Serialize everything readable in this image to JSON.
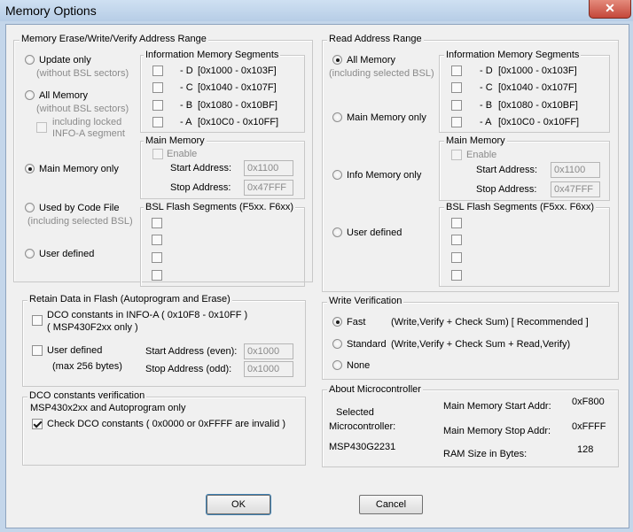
{
  "window": {
    "title": "Memory Options",
    "close_glyph": "✕"
  },
  "left_group": {
    "title": "Memory Erase/Write/Verify Address Range",
    "radios": [
      {
        "label": "Update only",
        "sub": "(without BSL sectors)",
        "selected": false
      },
      {
        "label": "All Memory",
        "sub": "(without BSL sectors)",
        "selected": false
      },
      {
        "label": "Main Memory only",
        "selected": true
      },
      {
        "label": "Used by Code File",
        "sub": "(including selected BSL)",
        "selected": false
      },
      {
        "label": "User defined",
        "selected": false
      }
    ],
    "locked_checkbox": {
      "line1": "including locked",
      "line2": "INFO-A segment",
      "checked": false
    },
    "info_segments": {
      "title": "Information Memory Segments",
      "rows": [
        {
          "label": "- D",
          "range": "[0x1000 - 0x103F]"
        },
        {
          "label": "- C",
          "range": "[0x1040 - 0x107F]"
        },
        {
          "label": "- B",
          "range": "[0x1080 - 0x10BF]"
        },
        {
          "label": "- A",
          "range": "[0x10C0 - 0x10FF]"
        }
      ]
    },
    "main_memory": {
      "title": "Main Memory",
      "enable_label": "Enable",
      "start_label": "Start Address:",
      "start_value": "0x1100",
      "stop_label": "Stop Address:",
      "stop_value": "0x47FFF"
    },
    "bsl_segments": {
      "title": "BSL Flash Segments (F5xx. F6xx)"
    }
  },
  "retain_group": {
    "title": "Retain Data in Flash  (Autoprogram and Erase)",
    "dco_line1": "DCO constants in INFO-A ( 0x10F8 - 0x10FF )",
    "dco_line2": "( MSP430F2xx only )",
    "user_defined_label": "User defined",
    "max_bytes": "(max 256 bytes)",
    "start_label": "Start Address (even):",
    "start_value": "0x1000",
    "stop_label": "Stop Address (odd):",
    "stop_value": "0x1000"
  },
  "dco_group": {
    "title": "DCO constants verification",
    "subtitle": "MSP430x2xx and Autoprogram only",
    "check_label": "Check DCO constants ( 0x0000 or 0xFFFF are invalid )",
    "checked": true
  },
  "read_group": {
    "title": "Read Address Range",
    "radios": [
      {
        "label": "All Memory",
        "sub": "(including selected BSL)",
        "selected": true
      },
      {
        "label": "Main Memory only",
        "selected": false
      },
      {
        "label": "Info Memory only",
        "selected": false
      },
      {
        "label": "User defined",
        "selected": false
      }
    ],
    "info_segments": {
      "title": "Information Memory Segments",
      "rows": [
        {
          "label": "- D",
          "range": "[0x1000 - 0x103F]"
        },
        {
          "label": "- C",
          "range": "[0x1040 - 0x107F]"
        },
        {
          "label": "- B",
          "range": "[0x1080 - 0x10BF]"
        },
        {
          "label": "- A",
          "range": "[0x10C0 - 0x10FF]"
        }
      ]
    },
    "main_memory": {
      "title": "Main Memory",
      "enable_label": "Enable",
      "start_label": "Start Address:",
      "start_value": "0x1100",
      "stop_label": "Stop Address:",
      "stop_value": "0x47FFF"
    },
    "bsl_segments": {
      "title": "BSL Flash Segments (F5xx. F6xx)"
    }
  },
  "write_verification": {
    "title": "Write Verification",
    "fast_label": "Fast",
    "fast_desc": "(Write,Verify + Check Sum)  [ Recommended ]",
    "standard_label": "Standard",
    "standard_desc": "(Write,Verify + Check Sum + Read,Verify)",
    "none_label": "None",
    "selected": "Fast"
  },
  "about": {
    "title": "About Microcontroller",
    "selected_label_1": "Selected",
    "selected_label_2": "Microcontroller:",
    "device": "MSP430G2231",
    "start_label": "Main Memory Start Addr:",
    "start_value": "0xF800",
    "stop_label": "Main Memory Stop Addr:",
    "stop_value": "0xFFFF",
    "ram_label": "RAM Size in Bytes:",
    "ram_value": "128"
  },
  "buttons": {
    "ok": "OK",
    "cancel": "Cancel"
  }
}
